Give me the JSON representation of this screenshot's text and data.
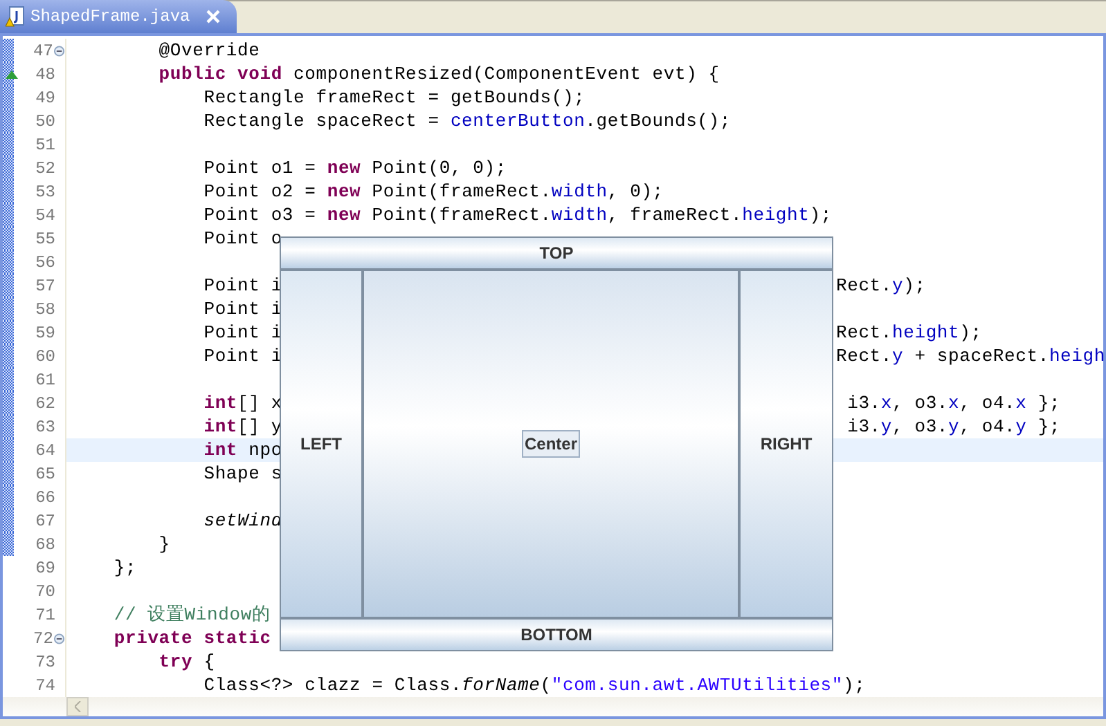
{
  "tab": {
    "title": "ShapedFrame.java",
    "selected": true
  },
  "editor": {
    "lines": [
      {
        "number": "47",
        "changed": true,
        "fold": true,
        "override": false,
        "highlighted": false,
        "left": [
          {
            "kind": "plain",
            "text": "        @Override"
          }
        ]
      },
      {
        "number": "48",
        "changed": true,
        "fold": false,
        "override": true,
        "highlighted": false,
        "left": [
          {
            "kind": "keyword",
            "text": "        public void"
          },
          {
            "kind": "plain",
            "text": " componentResized(ComponentEvent evt) {"
          }
        ]
      },
      {
        "number": "49",
        "changed": true,
        "fold": false,
        "override": false,
        "highlighted": false,
        "left": [
          {
            "kind": "plain",
            "text": "            Rectangle frameRect = getBounds();"
          }
        ]
      },
      {
        "number": "50",
        "changed": true,
        "fold": false,
        "override": false,
        "highlighted": false,
        "left": [
          {
            "kind": "plain",
            "text": "            Rectangle spaceRect = "
          },
          {
            "kind": "field",
            "text": "centerButton"
          },
          {
            "kind": "plain",
            "text": ".getBounds();"
          }
        ]
      },
      {
        "number": "51",
        "changed": true,
        "fold": false,
        "override": false,
        "highlighted": false
      },
      {
        "number": "52",
        "changed": true,
        "fold": false,
        "override": false,
        "highlighted": false,
        "left": [
          {
            "kind": "plain",
            "text": "            Point o1 = "
          },
          {
            "kind": "keyword",
            "text": "new"
          },
          {
            "kind": "plain",
            "text": " Point(0, 0);"
          }
        ]
      },
      {
        "number": "53",
        "changed": true,
        "fold": false,
        "override": false,
        "highlighted": false,
        "left": [
          {
            "kind": "plain",
            "text": "            Point o2 = "
          },
          {
            "kind": "keyword",
            "text": "new"
          },
          {
            "kind": "plain",
            "text": " Point(frameRect."
          },
          {
            "kind": "field",
            "text": "width"
          },
          {
            "kind": "plain",
            "text": ", 0);"
          }
        ]
      },
      {
        "number": "54",
        "changed": true,
        "fold": false,
        "override": false,
        "highlighted": false,
        "left": [
          {
            "kind": "plain",
            "text": "            Point o3 = "
          },
          {
            "kind": "keyword",
            "text": "new"
          },
          {
            "kind": "plain",
            "text": " Point(frameRect."
          },
          {
            "kind": "field",
            "text": "width"
          },
          {
            "kind": "plain",
            "text": ", frameRect."
          },
          {
            "kind": "field",
            "text": "height"
          },
          {
            "kind": "plain",
            "text": ");"
          }
        ]
      },
      {
        "number": "55",
        "changed": true,
        "fold": false,
        "override": false,
        "highlighted": false,
        "left": [
          {
            "kind": "plain",
            "text": "            Point o"
          }
        ]
      },
      {
        "number": "56",
        "changed": true,
        "fold": false,
        "override": false,
        "highlighted": false
      },
      {
        "number": "57",
        "changed": true,
        "fold": false,
        "override": false,
        "highlighted": false,
        "left": [
          {
            "kind": "plain",
            "text": "            Point i"
          }
        ],
        "right": [
          {
            "kind": "plain",
            "text": "Rect."
          },
          {
            "kind": "field",
            "text": "y"
          },
          {
            "kind": "plain",
            "text": ");"
          }
        ]
      },
      {
        "number": "58",
        "changed": true,
        "fold": false,
        "override": false,
        "highlighted": false,
        "left": [
          {
            "kind": "plain",
            "text": "            Point i"
          }
        ]
      },
      {
        "number": "59",
        "changed": true,
        "fold": false,
        "override": false,
        "highlighted": false,
        "left": [
          {
            "kind": "plain",
            "text": "            Point i"
          }
        ],
        "right": [
          {
            "kind": "plain",
            "text": "Rect."
          },
          {
            "kind": "field",
            "text": "height"
          },
          {
            "kind": "plain",
            "text": ");"
          }
        ]
      },
      {
        "number": "60",
        "changed": true,
        "fold": false,
        "override": false,
        "highlighted": false,
        "left": [
          {
            "kind": "plain",
            "text": "            Point i"
          }
        ],
        "right": [
          {
            "kind": "plain",
            "text": "Rect."
          },
          {
            "kind": "field",
            "text": "y"
          },
          {
            "kind": "plain",
            "text": " + spaceRect."
          },
          {
            "kind": "field",
            "text": "heigh"
          }
        ]
      },
      {
        "number": "61",
        "changed": true,
        "fold": false,
        "override": false,
        "highlighted": false
      },
      {
        "number": "62",
        "changed": true,
        "fold": false,
        "override": false,
        "highlighted": false,
        "left": [
          {
            "kind": "keyword",
            "text": "            int"
          },
          {
            "kind": "plain",
            "text": "[] x"
          }
        ],
        "right": [
          {
            "kind": "plain",
            "text": " i3."
          },
          {
            "kind": "field",
            "text": "x"
          },
          {
            "kind": "plain",
            "text": ", o3."
          },
          {
            "kind": "field",
            "text": "x"
          },
          {
            "kind": "plain",
            "text": ", o4."
          },
          {
            "kind": "field",
            "text": "x"
          },
          {
            "kind": "plain",
            "text": " };"
          }
        ]
      },
      {
        "number": "63",
        "changed": true,
        "fold": false,
        "override": false,
        "highlighted": false,
        "left": [
          {
            "kind": "keyword",
            "text": "            int"
          },
          {
            "kind": "plain",
            "text": "[] y"
          }
        ],
        "right": [
          {
            "kind": "plain",
            "text": " i3."
          },
          {
            "kind": "field",
            "text": "y"
          },
          {
            "kind": "plain",
            "text": ", o3."
          },
          {
            "kind": "field",
            "text": "y"
          },
          {
            "kind": "plain",
            "text": ", o4."
          },
          {
            "kind": "field",
            "text": "y"
          },
          {
            "kind": "plain",
            "text": " };"
          }
        ]
      },
      {
        "number": "64",
        "changed": true,
        "fold": false,
        "override": false,
        "highlighted": true,
        "left": [
          {
            "kind": "keyword",
            "text": "            int"
          },
          {
            "kind": "plain",
            "text": " npo"
          }
        ]
      },
      {
        "number": "65",
        "changed": true,
        "fold": false,
        "override": false,
        "highlighted": false,
        "left": [
          {
            "kind": "plain",
            "text": "            Shape s"
          }
        ]
      },
      {
        "number": "66",
        "changed": true,
        "fold": false,
        "override": false,
        "highlighted": false
      },
      {
        "number": "67",
        "changed": true,
        "fold": false,
        "override": false,
        "highlighted": false,
        "left": [
          {
            "kind": "italic",
            "text": "            setWind"
          }
        ]
      },
      {
        "number": "68",
        "changed": true,
        "fold": false,
        "override": false,
        "highlighted": false,
        "left": [
          {
            "kind": "plain",
            "text": "        }"
          }
        ]
      },
      {
        "number": "69",
        "changed": false,
        "fold": false,
        "override": false,
        "highlighted": false,
        "left": [
          {
            "kind": "plain",
            "text": "    };"
          }
        ]
      },
      {
        "number": "70",
        "changed": false,
        "fold": false,
        "override": false,
        "highlighted": false
      },
      {
        "number": "71",
        "changed": false,
        "fold": false,
        "override": false,
        "highlighted": false,
        "left": [
          {
            "kind": "comment",
            "text": "    // 设置Window的"
          }
        ]
      },
      {
        "number": "72",
        "changed": false,
        "fold": true,
        "override": false,
        "highlighted": false,
        "left": [
          {
            "kind": "keyword",
            "text": "    private static"
          }
        ]
      },
      {
        "number": "73",
        "changed": false,
        "fold": false,
        "override": false,
        "highlighted": false,
        "left": [
          {
            "kind": "keyword",
            "text": "        try"
          },
          {
            "kind": "plain",
            "text": " {"
          }
        ]
      },
      {
        "number": "74",
        "changed": false,
        "fold": false,
        "override": false,
        "highlighted": false,
        "left": [
          {
            "kind": "plain",
            "text": "            Class<?> clazz = Class."
          },
          {
            "kind": "italic",
            "text": "forName"
          },
          {
            "kind": "plain",
            "text": "("
          },
          {
            "kind": "string",
            "text": "\"com.sun.awt.AWTUtilities\""
          },
          {
            "kind": "plain",
            "text": ");"
          }
        ]
      }
    ]
  },
  "frame": {
    "top": "TOP",
    "left": "LEFT",
    "center": "Center",
    "right": "RIGHT",
    "bottom": "BOTTOM"
  }
}
